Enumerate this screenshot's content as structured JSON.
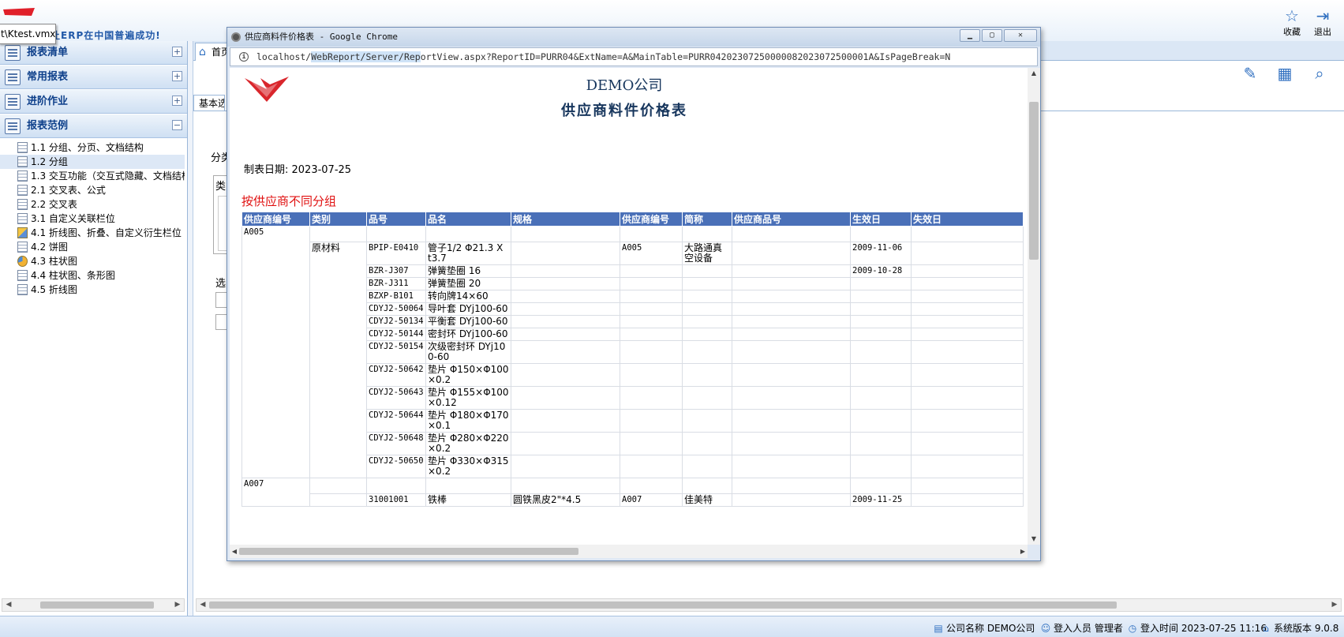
{
  "header": {
    "slogan": "让ERP在中国普遍成功!",
    "tooltip": "t\\Ktest.vmx",
    "favorite_label": "收藏",
    "exit_label": "退出",
    "favorite_icon": "star-icon",
    "exit_icon": "exit-icon"
  },
  "sidebar": {
    "sections": [
      {
        "label": "报表清单",
        "toggle": "+"
      },
      {
        "label": "常用报表",
        "toggle": "+"
      },
      {
        "label": "进阶作业",
        "toggle": "+"
      },
      {
        "label": "报表范例",
        "toggle": "−"
      }
    ],
    "tree": [
      {
        "label": "1.1 分组、分页、文档结构",
        "icon": "report-icon"
      },
      {
        "label": "1.2 分组",
        "icon": "report-icon",
        "selected": true
      },
      {
        "label": "1.3 交互功能（交互式隐藏、文档结构",
        "icon": "report-icon"
      },
      {
        "label": "2.1 交叉表、公式",
        "icon": "report-icon"
      },
      {
        "label": "2.2 交叉表",
        "icon": "report-icon"
      },
      {
        "label": "3.1 自定义关联栏位",
        "icon": "report-icon"
      },
      {
        "label": "4.1 折线图、折叠、自定义衍生栏位",
        "icon": "line-chart-icon"
      },
      {
        "label": "4.2 饼图",
        "icon": "report-icon"
      },
      {
        "label": "4.3 柱状图",
        "icon": "pie-chart-icon"
      },
      {
        "label": "4.4 柱状图、条形图",
        "icon": "report-icon"
      },
      {
        "label": "4.5 折线图",
        "icon": "report-icon"
      }
    ]
  },
  "main": {
    "home_tab": "首页",
    "basic_tab": "基本选项",
    "frag_group": "分类",
    "frag_type": "类",
    "frag_select": "选"
  },
  "popup": {
    "title": "供应商料件价格表 - Google Chrome",
    "url_pre": "localhost/",
    "url_hl": "WebReport/Server/Rep",
    "url_post": "ortView.aspx?ReportID=PURR04&ExtName=A&MainTable=PURR04202307250000082023072500001A&IsPageBreak=N",
    "report": {
      "company": "DEMO公司",
      "title": "供应商料件价格表",
      "date_label": "制表日期: 2023-07-25",
      "group_title": "按供应商不同分组",
      "columns": [
        "供应商编号",
        "类别",
        "品号",
        "品名",
        "规格",
        "供应商编号",
        "简称",
        "供应商品号",
        "生效日",
        "失效日"
      ],
      "group1": "A005",
      "category1": "原材料",
      "rows": [
        {
          "code": "BPIP-E0410",
          "name": "管子1/2 Φ21.3 X t3.7",
          "vendor": "A005",
          "short": "大路通真空设备",
          "eff": "2009-11-06"
        },
        {
          "code": "BZR-J307",
          "name": "弹簧垫圈 16",
          "vendor": "",
          "short": "",
          "eff": "2009-10-28"
        },
        {
          "code": "BZR-J311",
          "name": "弹簧垫圈 20",
          "vendor": "",
          "short": "",
          "eff": ""
        },
        {
          "code": "BZXP-B101",
          "name": "转向牌14×60",
          "vendor": "",
          "short": "",
          "eff": ""
        },
        {
          "code": "CDYJ2-50064",
          "name": "导叶套 DYj100-60",
          "vendor": "",
          "short": "",
          "eff": ""
        },
        {
          "code": "CDYJ2-50134",
          "name": "平衡套 DYj100-60",
          "vendor": "",
          "short": "",
          "eff": ""
        },
        {
          "code": "CDYJ2-50144",
          "name": "密封环 DYj100-60",
          "vendor": "",
          "short": "",
          "eff": ""
        },
        {
          "code": "CDYJ2-50154",
          "name": "次级密封环 DYj100-60",
          "vendor": "",
          "short": "",
          "eff": ""
        },
        {
          "code": "CDYJ2-50642",
          "name": "垫片 Φ150×Φ100×0.2",
          "vendor": "",
          "short": "",
          "eff": ""
        },
        {
          "code": "CDYJ2-50643",
          "name": "垫片 Φ155×Φ100×0.12",
          "vendor": "",
          "short": "",
          "eff": ""
        },
        {
          "code": "CDYJ2-50644",
          "name": "垫片 Φ180×Φ170×0.1",
          "vendor": "",
          "short": "",
          "eff": ""
        },
        {
          "code": "CDYJ2-50648",
          "name": "垫片 Φ280×Φ220×0.2",
          "vendor": "",
          "short": "",
          "eff": ""
        },
        {
          "code": "CDYJ2-50650",
          "name": "垫片 Φ330×Φ315×0.2",
          "vendor": "",
          "short": "",
          "eff": ""
        }
      ],
      "group2": "A007",
      "row_partial": {
        "code": "31001001",
        "name": "铁棒",
        "spec": "圆铁黑皮2\"*4.5",
        "vendor": "A007",
        "short": "佳美特",
        "eff": "2009-11-25"
      }
    }
  },
  "status": {
    "company": "公司名称 DEMO公司",
    "user": "登入人员 管理者",
    "login_time": "登入时间 2023-07-25 11:16",
    "version": "系统版本 9.0.8"
  }
}
